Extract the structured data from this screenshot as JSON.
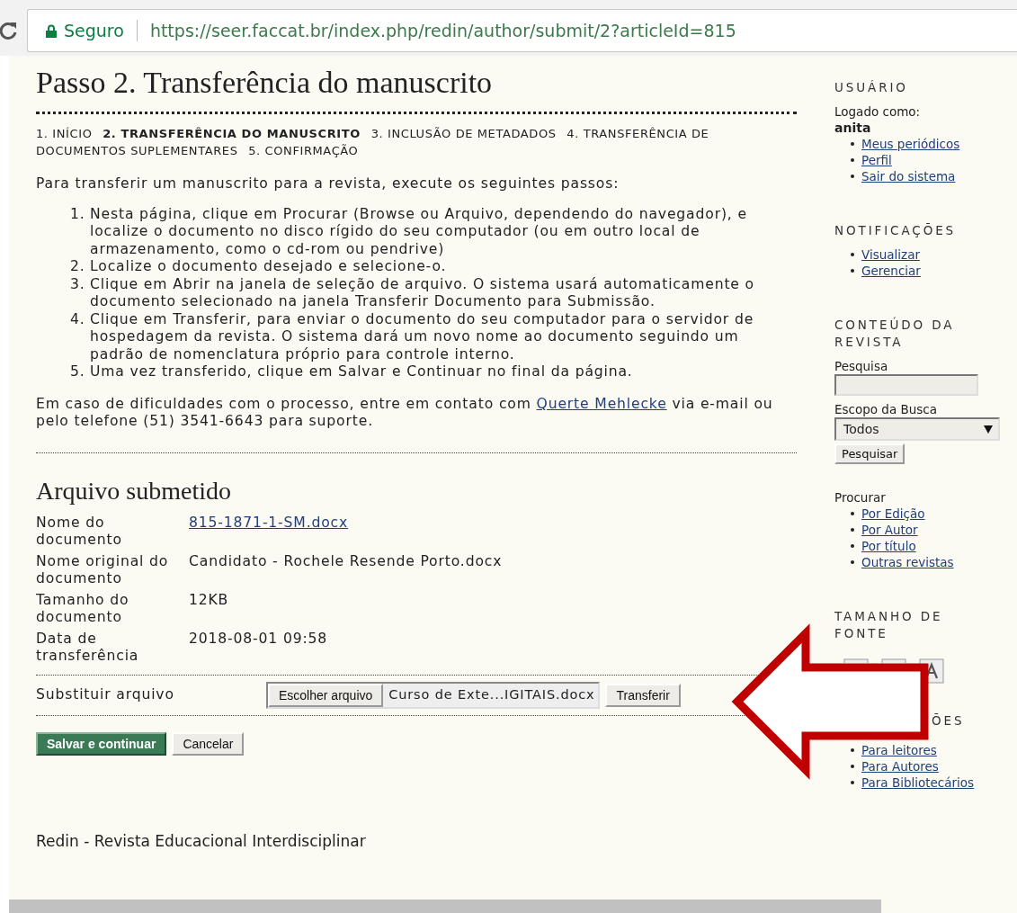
{
  "browser": {
    "security_label": "Seguro",
    "url": "https://seer.faccat.br/index.php/redin/author/submit/2?articleId=815"
  },
  "main": {
    "title": "Passo 2. Transferência do manuscrito",
    "steps": [
      {
        "label": "1. INÍCIO",
        "selected": false
      },
      {
        "label": "2. TRANSFERÊNCIA DO MANUSCRITO",
        "selected": true
      },
      {
        "label": "3. INCLUSÃO DE METADADOS",
        "selected": false
      },
      {
        "label": "4. TRANSFERÊNCIA DE DOCUMENTOS SUPLEMENTARES",
        "selected": false
      },
      {
        "label": "5. CONFIRMAÇÃO",
        "selected": false
      }
    ],
    "intro": "Para transferir um manuscrito para a revista, execute os seguintes passos:",
    "instructions": [
      {
        "number": "1.",
        "text": "Nesta página, clique em Procurar (Browse ou Arquivo, dependendo do navegador), e localize o documento no disco rígido do seu computador (ou em outro local de armazenamento, como o cd-rom ou pendrive)"
      },
      {
        "number": "2.",
        "text": "Localize o documento desejado e selecione-o."
      },
      {
        "number": "3.",
        "text": "Clique em Abrir na janela de seleção de arquivo. O sistema usará automaticamente o documento selecionado na janela Transferir Documento para Submissão."
      },
      {
        "number": "4.",
        "text": "Clique em Transferir, para enviar o documento do seu computador para o servidor de hospedagem da revista. O sistema dará um novo nome ao documento seguindo um padrão de nomenclatura próprio para controle interno."
      },
      {
        "number": "5.",
        "text": "Uma vez transferido, clique em Salvar e Continuar no final da página."
      }
    ],
    "contact": {
      "before": "Em caso de dificuldades com o processo, entre em contato com",
      "link": "Querte Mehlecke",
      "after": "via e-mail ou pelo telefone (51) 3541-6643 para suporte."
    },
    "file_section": {
      "title": "Arquivo submetido",
      "rows": [
        {
          "label": "Nome do documento",
          "value": "815-1871-1-SM.docx",
          "kind": "link"
        },
        {
          "label": "Nome original do documento",
          "value": "Candidato - Rochele Resende Porto.docx",
          "kind": "text"
        },
        {
          "label": "Tamanho do documento",
          "value": "12KB",
          "kind": "text"
        },
        {
          "label": "Data de transferência",
          "value": "2018-08-01 09:58",
          "kind": "text"
        }
      ],
      "replace": {
        "label": "Substituir arquivo",
        "choose_button": "Escolher arquivo",
        "file_name": "Curso de Exte...IGITAIS.docx",
        "upload_button": "Transferir"
      }
    },
    "buttons": [
      {
        "label": "Salvar e continuar",
        "kind": "primary"
      },
      {
        "label": "Cancelar",
        "kind": "secondary"
      }
    ],
    "footer": "Redin - Revista Educacional Interdisciplinar"
  },
  "sidebar": [
    {
      "kind": "user",
      "title": "USUÁRIO",
      "logged_label": "Logado como:",
      "username": "anita",
      "links": [
        "Meus periódicos",
        "Perfil",
        "Sair do sistema"
      ]
    },
    {
      "kind": "links",
      "title": "NOTIFICAÇÕES",
      "links": [
        "Visualizar",
        "Gerenciar"
      ]
    },
    {
      "kind": "search",
      "title": "CONTEÚDO DA REVISTA",
      "search_label": "Pesquisa",
      "scope_label": "Escopo da Busca",
      "scope_value": "Todos",
      "button": "Pesquisar",
      "browse_label": "Procurar",
      "links": [
        "Por Edição",
        "Por Autor",
        "Por título",
        "Outras revistas"
      ]
    },
    {
      "kind": "font-size",
      "title": "TAMANHO DE FONTE"
    },
    {
      "kind": "clipped",
      "title": "ÕES",
      "links": [
        "Para leitores",
        "Para Autores",
        "Para Bibliotecários"
      ]
    }
  ],
  "annotation": {
    "kind": "arrow"
  }
}
